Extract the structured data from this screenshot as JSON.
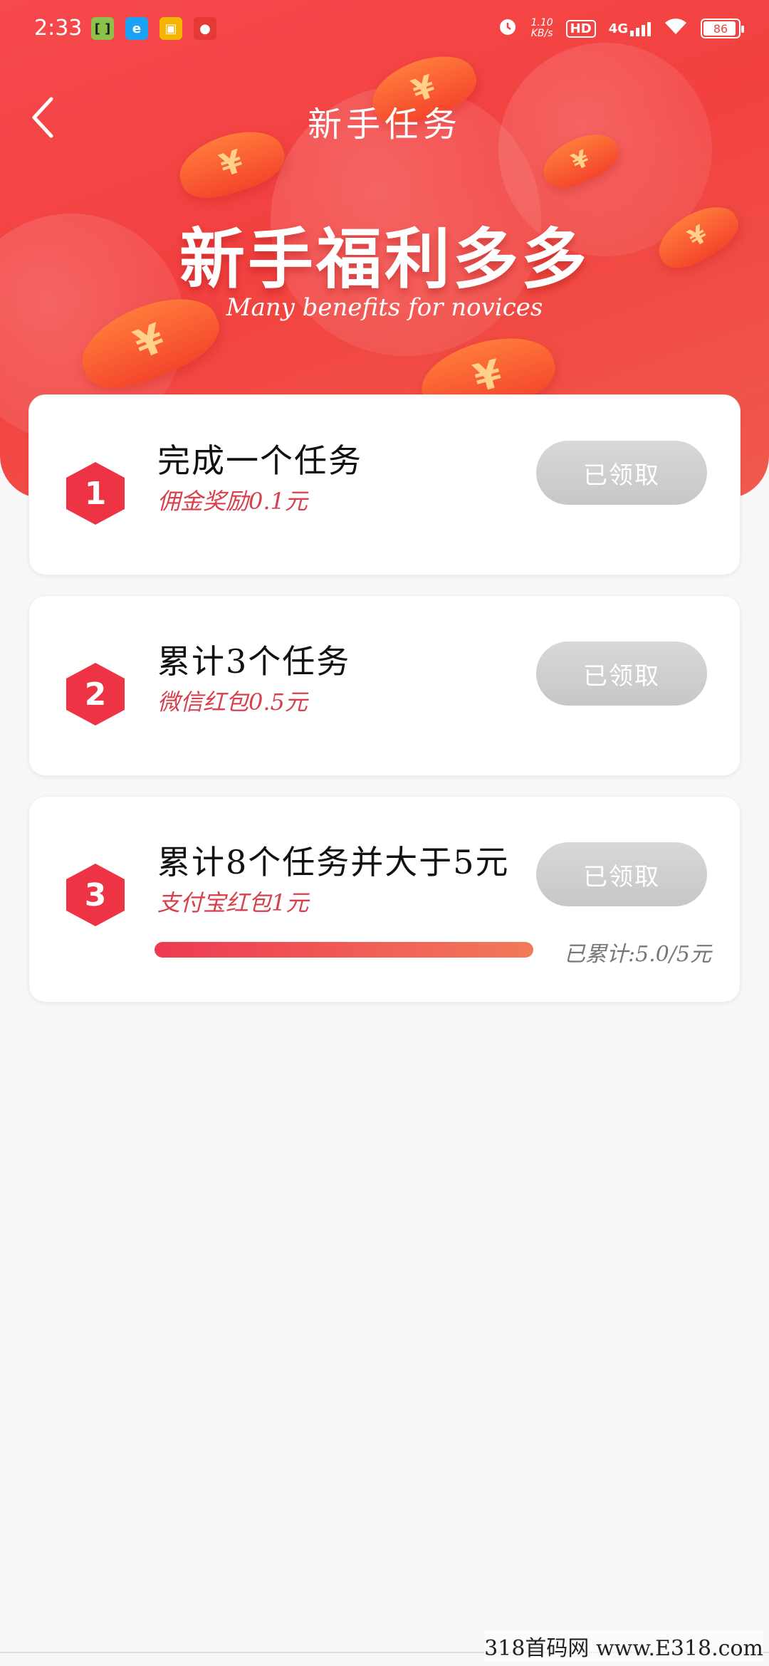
{
  "status_bar": {
    "time": "2:33",
    "network_speed_value": "1.10",
    "network_speed_unit": "KB/s",
    "hd_label": "HD",
    "signal_label": "4G",
    "battery": "86"
  },
  "header": {
    "title": "新手任务",
    "banner_title": "新手福利多多",
    "banner_subtitle": "Many benefits for novices"
  },
  "tasks": [
    {
      "number": "1",
      "title": "完成一个任务",
      "reward": "佣金奖励0.1元",
      "button_label": "已领取"
    },
    {
      "number": "2",
      "title": "累计3个任务",
      "reward": "微信红包0.5元",
      "button_label": "已领取"
    },
    {
      "number": "3",
      "title": "累计8个任务并大于5元",
      "reward": "支付宝红包1元",
      "button_label": "已领取",
      "progress_text": "已累计:5.0/5元",
      "progress_fraction": 1.0
    }
  ],
  "watermark": "318首码网 www.E318.com",
  "colors": {
    "hero_red": "#f2413f",
    "reward_red": "#d8404c",
    "hex_red": "#ee3344",
    "button_gray": "#cccccc"
  }
}
